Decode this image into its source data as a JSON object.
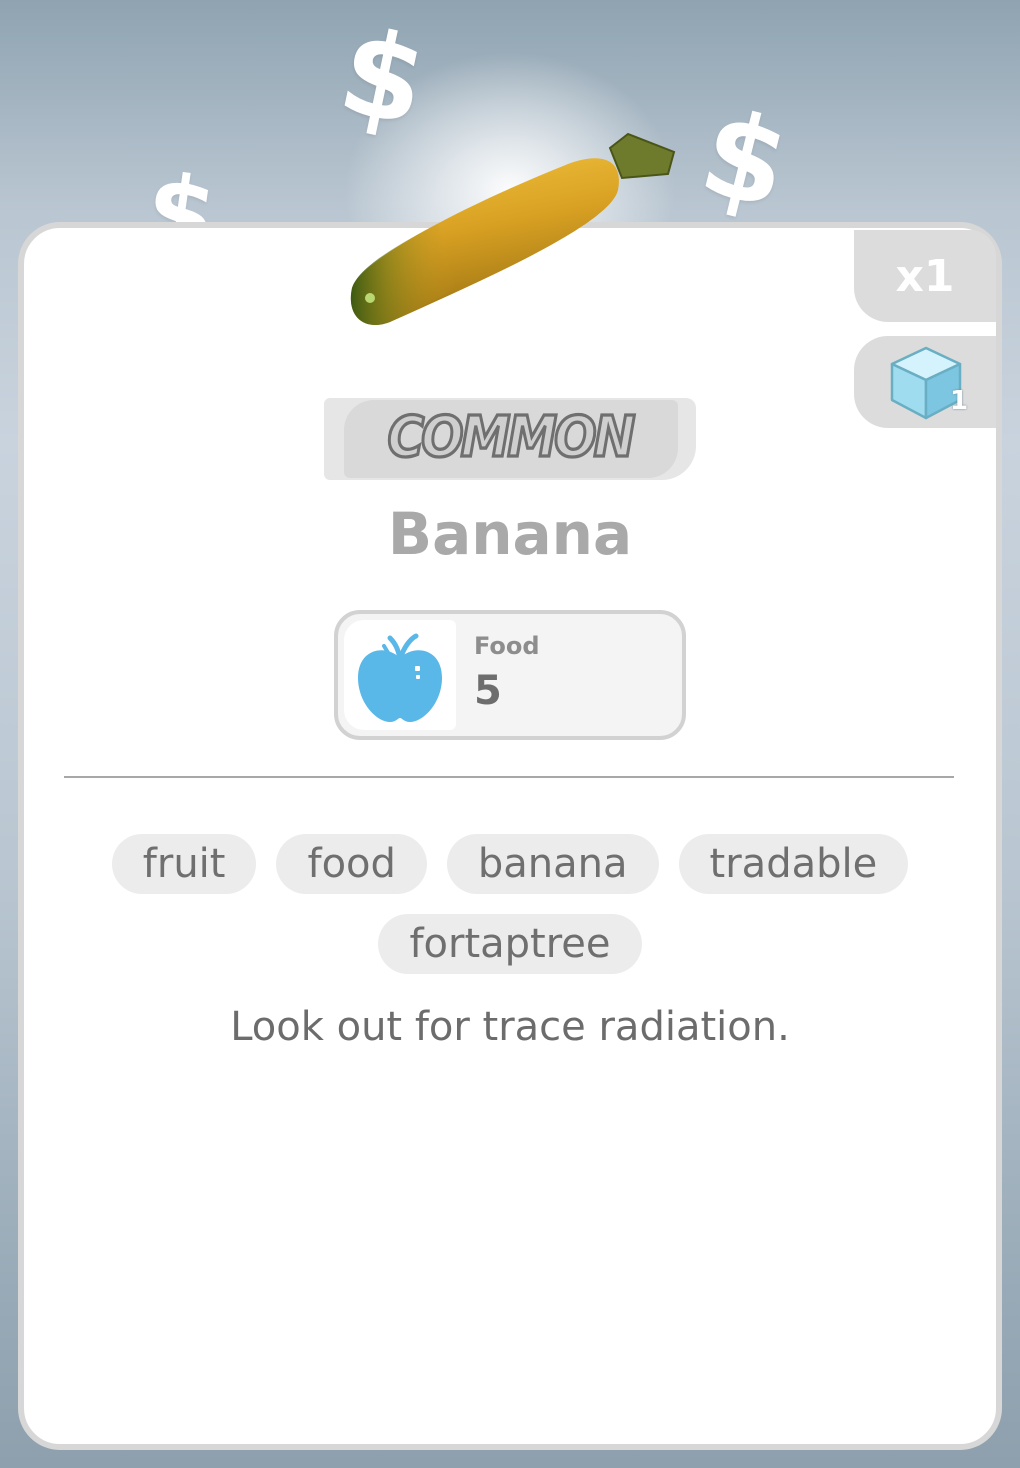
{
  "item": {
    "quantity": "x1",
    "cube_count": "1",
    "rarity": "COMMON",
    "name": "Banana",
    "stat": {
      "label": "Food",
      "value": "5",
      "icon": "apple-icon"
    },
    "tags": [
      "fruit",
      "food",
      "banana",
      "tradable",
      "fortaptree"
    ],
    "description": "Look out for trace radiation."
  },
  "decor": {
    "background_icon": "dollar-sign",
    "dollar_glyph": "$"
  },
  "colors": {
    "card_background": "#ffffff",
    "card_border": "#d7d7d7",
    "stat_icon": "#5ab8e8",
    "cube": "#9fdcf0"
  }
}
